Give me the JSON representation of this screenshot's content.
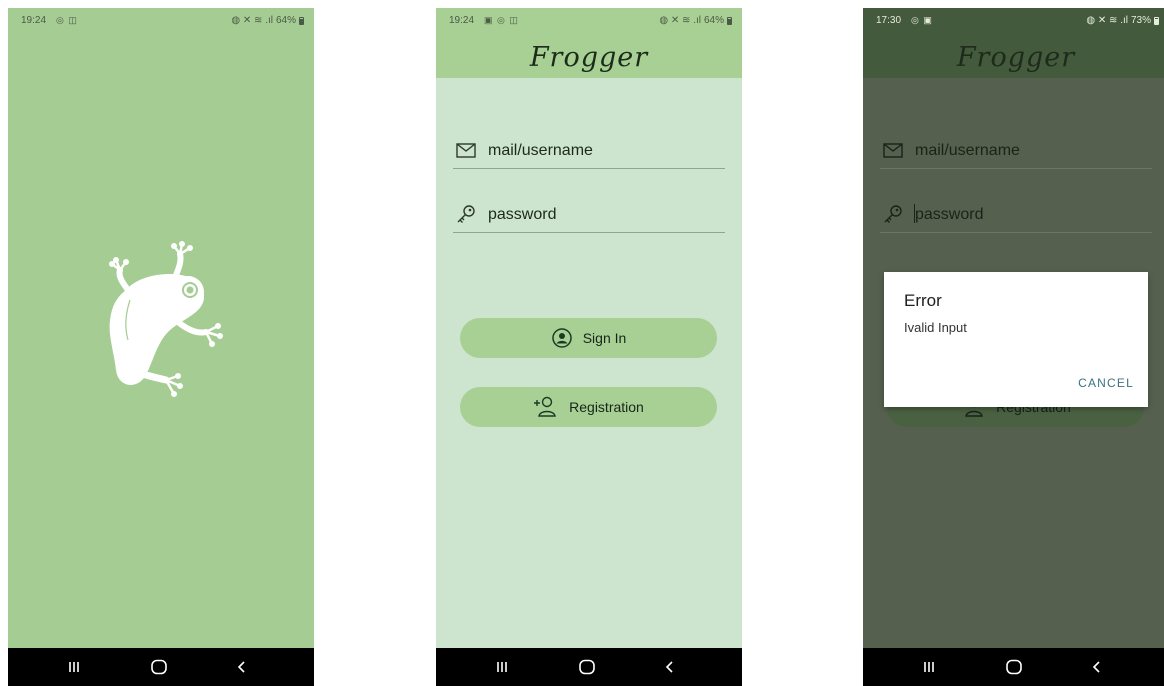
{
  "colors": {
    "splash_bg": "#a5cd93",
    "login_bg": "#cde4cf",
    "appbar": "#a8d094",
    "button": "#a8d094",
    "accent_text": "#3c7184",
    "navbar": "#000000"
  },
  "screens": [
    {
      "name": "splash",
      "status": {
        "time": "19:24",
        "left_icons": "◎ ◫",
        "right_icons": "◍ ✕ ≋ .ıl",
        "battery": "64%"
      },
      "logo_icon": "frog-logo-icon"
    },
    {
      "name": "login",
      "status": {
        "time": "19:24",
        "left_icons": "▣ ◎ ◫",
        "right_icons": "◍ ✕ ≋ .ıl",
        "battery": "64%"
      },
      "title": "Frogger",
      "email_placeholder": "mail/username",
      "password_placeholder": "password",
      "signin_label": "Sign In",
      "registration_label": "Registration"
    },
    {
      "name": "login-error",
      "status": {
        "time": "17:30",
        "left_icons": "◎ ▣",
        "right_icons": "◍ ✕ ≋ .ıl",
        "battery": "73%"
      },
      "title": "Frogger",
      "email_placeholder": "mail/username",
      "password_placeholder": "password",
      "registration_label": "Registration",
      "dialog": {
        "title": "Error",
        "message": "Ivalid Input",
        "cancel_label": "CANCEL"
      }
    }
  ],
  "navbar": {
    "icons": [
      "recent-apps-icon",
      "home-icon",
      "back-icon"
    ]
  }
}
